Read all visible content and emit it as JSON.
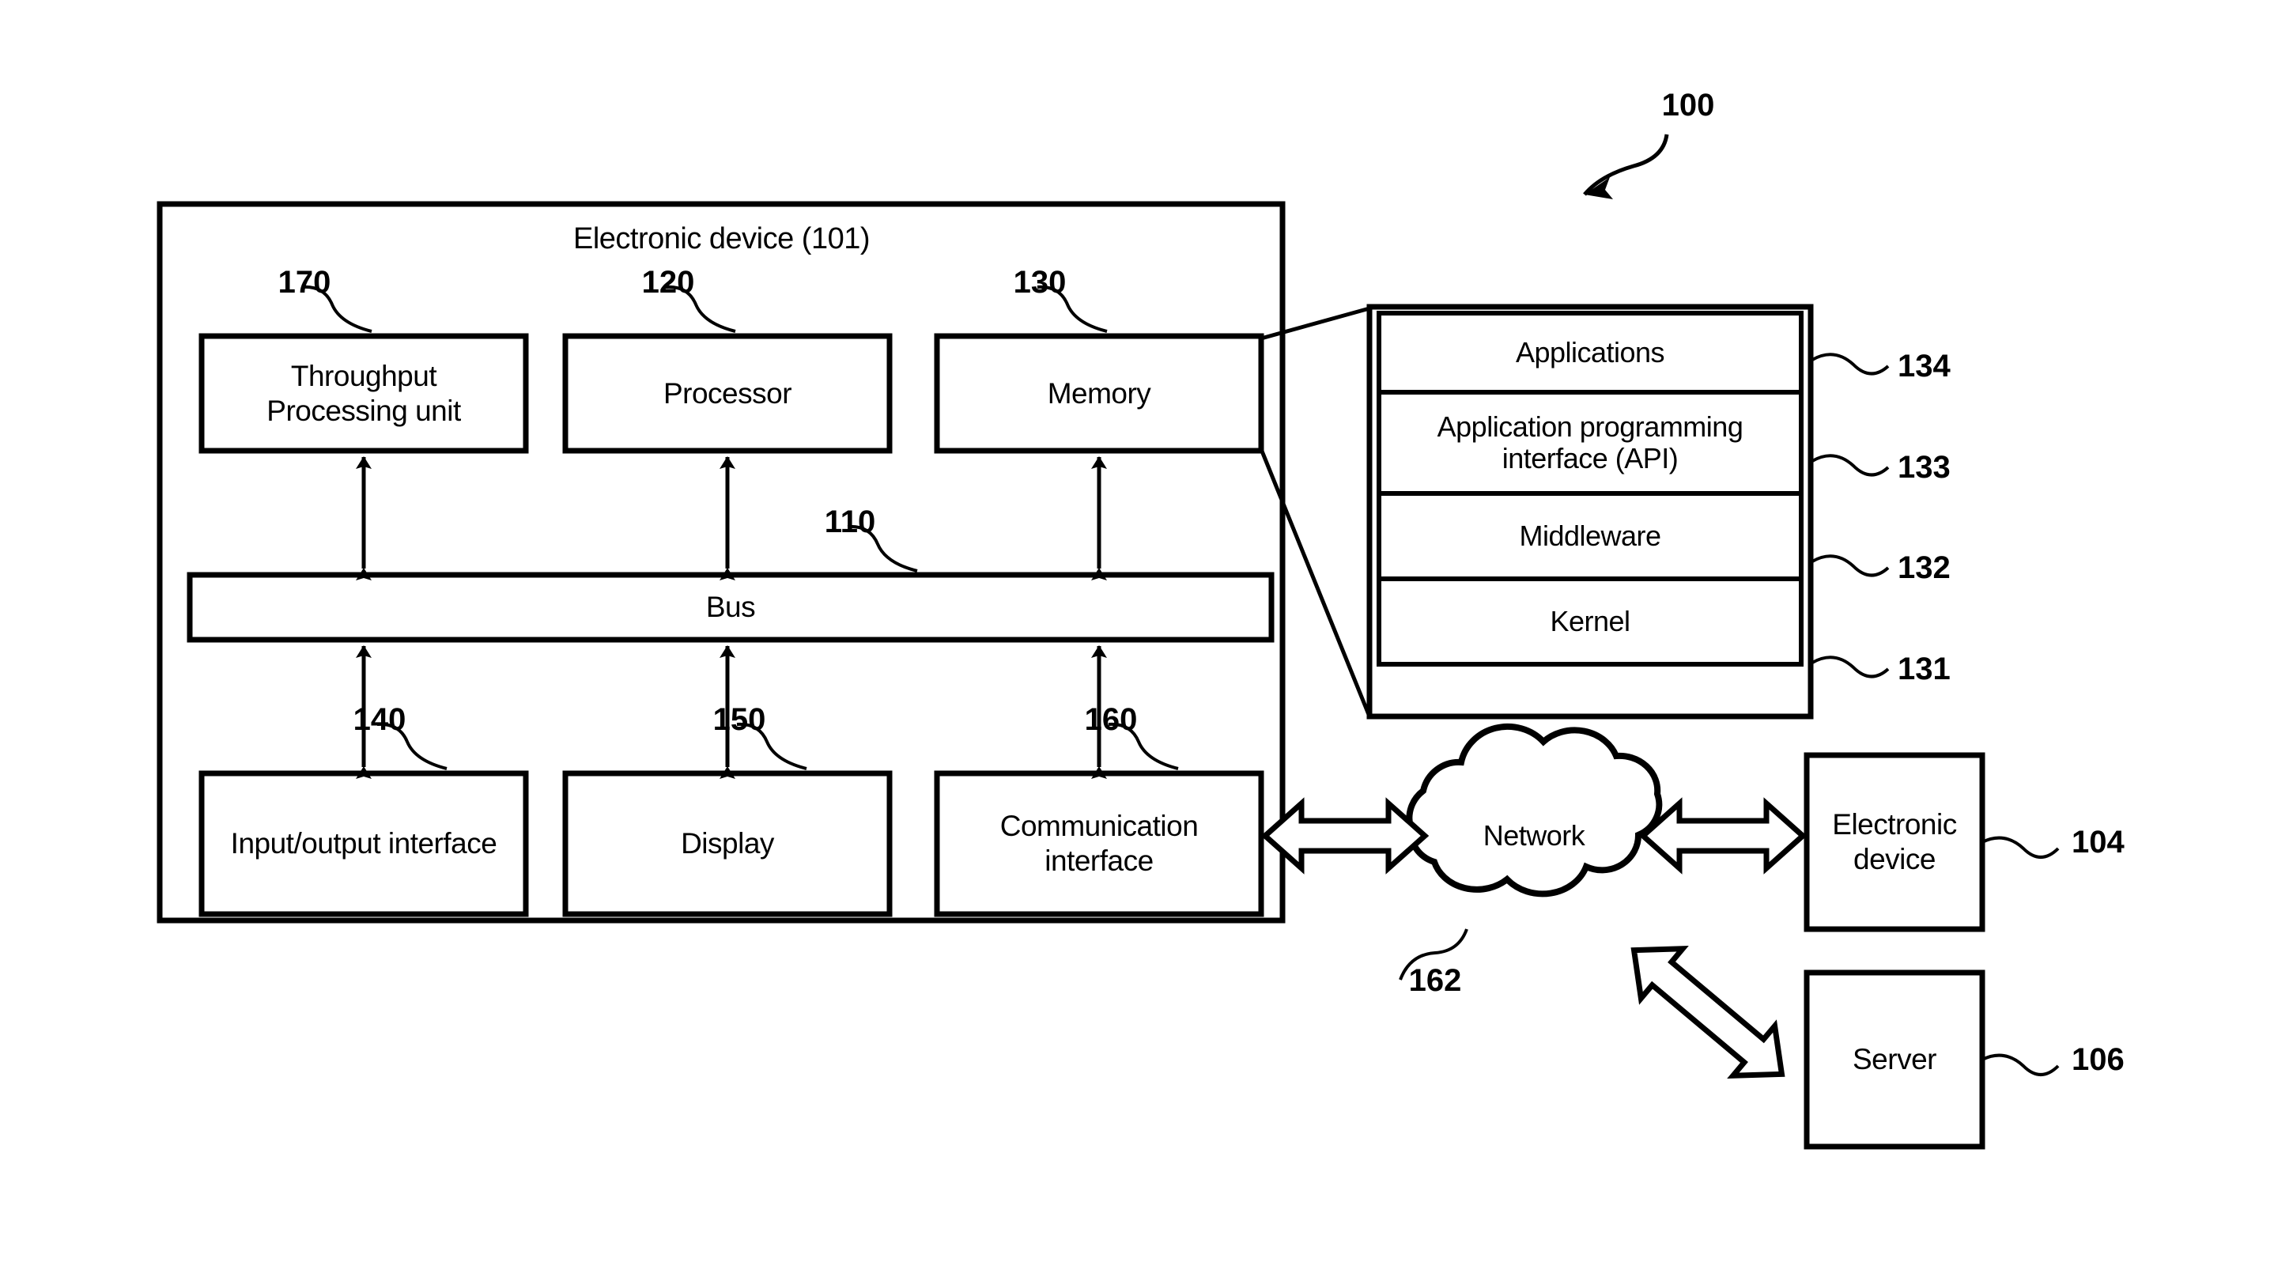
{
  "figure": {
    "system_ref": "100",
    "device_frame": {
      "title": "Electronic device (101)"
    }
  },
  "device_blocks": [
    {
      "id": "tpu",
      "label": "Throughput\nProcessing unit",
      "line1": "Throughput",
      "line2": "Processing unit",
      "ref": "170"
    },
    {
      "id": "processor",
      "label": "Processor",
      "line1": "Processor",
      "line2": "",
      "ref": "120"
    },
    {
      "id": "memory",
      "label": "Memory",
      "line1": "Memory",
      "line2": "",
      "ref": "130"
    },
    {
      "id": "bus",
      "label": "Bus",
      "line1": "Bus",
      "line2": "",
      "ref": "110"
    },
    {
      "id": "io",
      "label": "Input/output interface",
      "line1": "Input/output interface",
      "line2": "",
      "ref": "140"
    },
    {
      "id": "display",
      "label": "Display",
      "line1": "Display",
      "line2": "",
      "ref": "150"
    },
    {
      "id": "comm",
      "label": "Communication\ninterface",
      "line1": "Communication",
      "line2": "interface",
      "ref": "160"
    }
  ],
  "program_stack": [
    {
      "id": "applications",
      "line1": "Applications",
      "line2": "",
      "ref": "134"
    },
    {
      "id": "api",
      "line1": "Application programming",
      "line2": "interface (API)",
      "ref": "133"
    },
    {
      "id": "middleware",
      "line1": "Middleware",
      "line2": "",
      "ref": "132"
    },
    {
      "id": "kernel",
      "line1": "Kernel",
      "line2": "",
      "ref": "131"
    }
  ],
  "network": {
    "label": "Network",
    "ref": "162"
  },
  "external_nodes": [
    {
      "id": "external-electronic-device",
      "line1": "Electronic",
      "line2": "device",
      "ref": "104"
    },
    {
      "id": "server",
      "line1": "Server",
      "line2": "",
      "ref": "106"
    }
  ],
  "colors": {
    "ink": "#000000",
    "paper": "#ffffff"
  }
}
